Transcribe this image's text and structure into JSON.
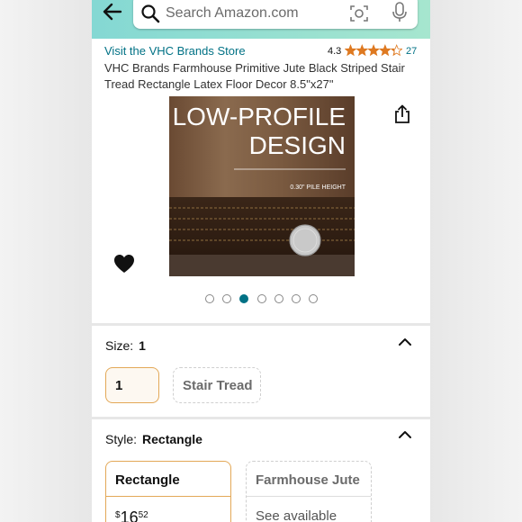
{
  "search": {
    "placeholder": "Search Amazon.com"
  },
  "product": {
    "store_link": "Visit the VHC Brands Store",
    "rating": "4.3",
    "stars_filled": 4.3,
    "rating_count": "27",
    "title": "VHC Brands Farmhouse Primitive Jute Black Striped Stair Tread Rectangle Latex Floor Decor 8.5\"x27\"",
    "image": {
      "headline_1": "LOW-PROFILE",
      "headline_2": "DESIGN",
      "caption": "0.30\" PILE HEIGHT"
    },
    "image_dots": {
      "count": 7,
      "active_index": 2
    }
  },
  "size_section": {
    "label": "Size:",
    "selected": "1",
    "options": [
      "1",
      "Stair Tread"
    ]
  },
  "style_section": {
    "label": "Style:",
    "selected": "Rectangle",
    "options": [
      {
        "name": "Rectangle",
        "price_symbol": "$",
        "price_whole": "16",
        "price_fraction": "52"
      },
      {
        "name": "Farmhouse Jute",
        "availability": "See available"
      }
    ]
  },
  "colors": {
    "link": "#007185",
    "selected_border": "#e3a857",
    "header_start": "#84d8d3",
    "header_end": "#a6e6cf",
    "star": "#de7921"
  },
  "icons": [
    "back-arrow-icon",
    "search-icon",
    "camera-icon",
    "mic-icon",
    "share-icon",
    "heart-icon",
    "chevron-up-icon",
    "star-icon"
  ]
}
